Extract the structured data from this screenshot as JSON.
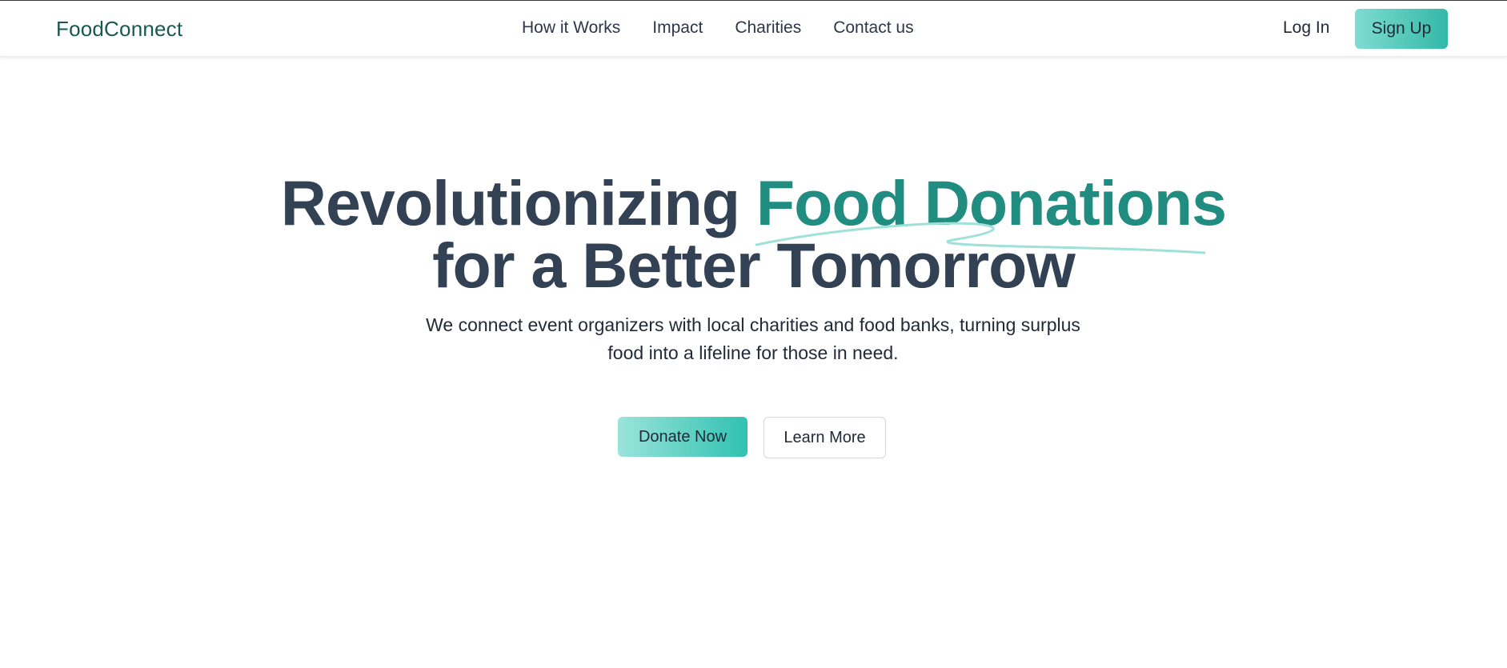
{
  "brand": {
    "name": "FoodConnect",
    "color": "#17594f"
  },
  "nav": {
    "items": [
      {
        "label": "How it Works"
      },
      {
        "label": "Impact"
      },
      {
        "label": "Charities"
      },
      {
        "label": "Contact us"
      }
    ]
  },
  "auth": {
    "login_label": "Log In",
    "signup_label": "Sign Up"
  },
  "hero": {
    "headline_part1": "Revolutionizing ",
    "headline_accent": "Food Donations",
    "headline_line2": "for a Better Tomorrow",
    "subtitle_line1": "We connect event organizers with local charities and food banks, turning surplus",
    "subtitle_line2": "food into a lifeline for those in need.",
    "donate_label": "Donate Now",
    "learn_label": "Learn More"
  },
  "colors": {
    "accent": "#218c80",
    "heading": "#334155",
    "button_gradient_start": "#9be3da",
    "button_gradient_end": "#2fc2b1"
  }
}
